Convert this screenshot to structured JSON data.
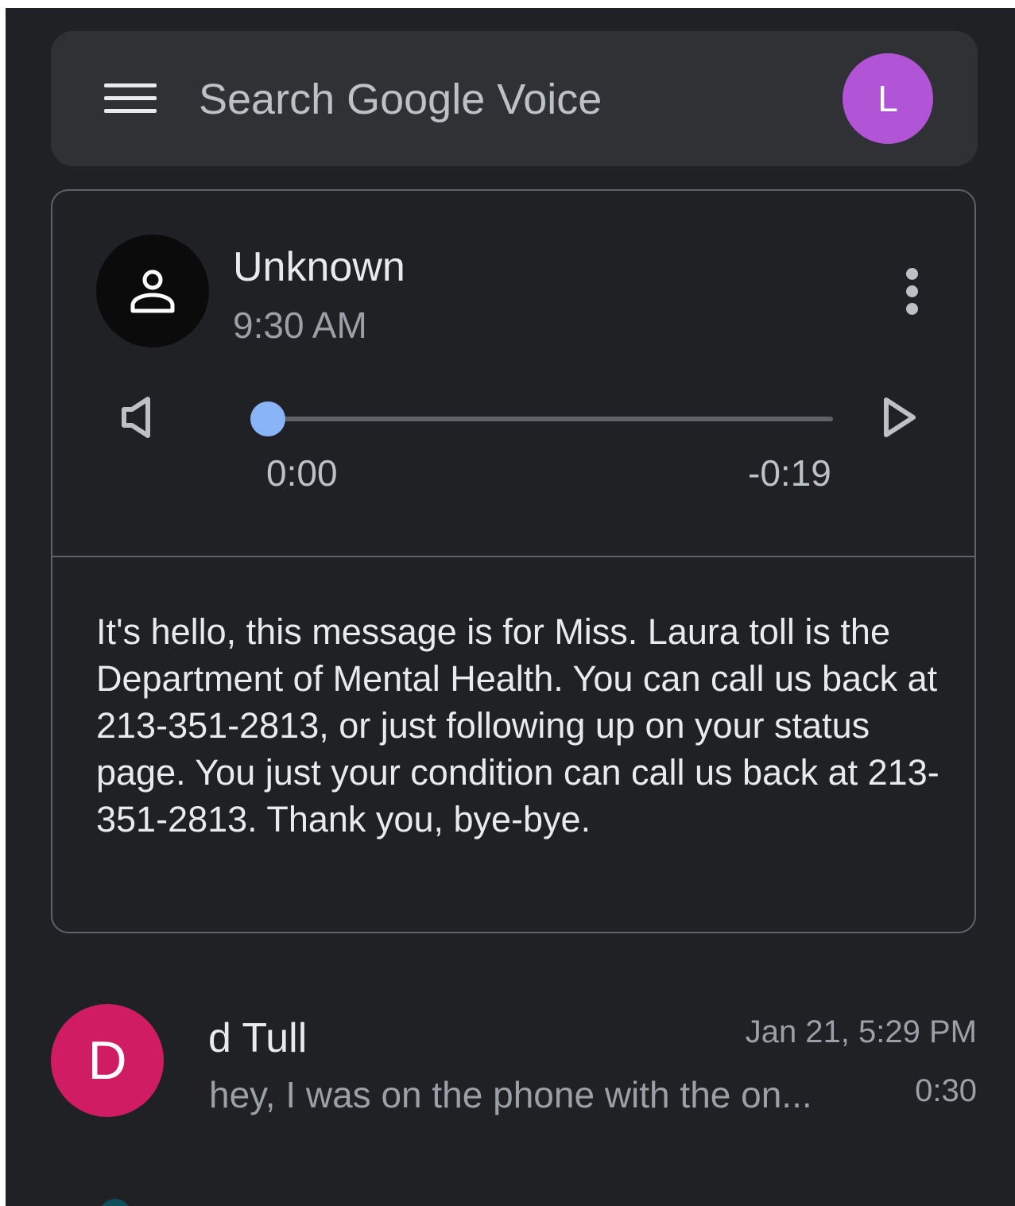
{
  "search": {
    "placeholder": "Search Google Voice"
  },
  "account": {
    "avatar_letter": "L",
    "avatar_color": "#b155d6"
  },
  "voicemail": {
    "caller_name": "Unknown",
    "time": "9:30 AM",
    "player": {
      "elapsed": "0:00",
      "remaining": "-0:19",
      "progress": 0
    },
    "transcript": "It's hello, this message is for Miss. Laura toll is the Department of Mental Health. You can call us back at 213-351-2813, or just following up on your status page. You just your condition can call us back at 213-351-2813. Thank you, bye-bye."
  },
  "list": {
    "items": [
      {
        "avatar_letter": "D",
        "avatar_color": "#d01c62",
        "name": "d Tull",
        "date": "Jan 21, 5:29 PM",
        "snippet": "hey, I was on the phone with the on...",
        "duration": "0:30"
      }
    ]
  },
  "icons": {
    "menu": "menu-icon",
    "more": "more-vert-icon",
    "speaker": "speaker-icon",
    "play": "play-icon",
    "person": "person-icon"
  },
  "colors": {
    "background": "#202124",
    "surface": "#303134",
    "accent": "#8ab4f8"
  }
}
